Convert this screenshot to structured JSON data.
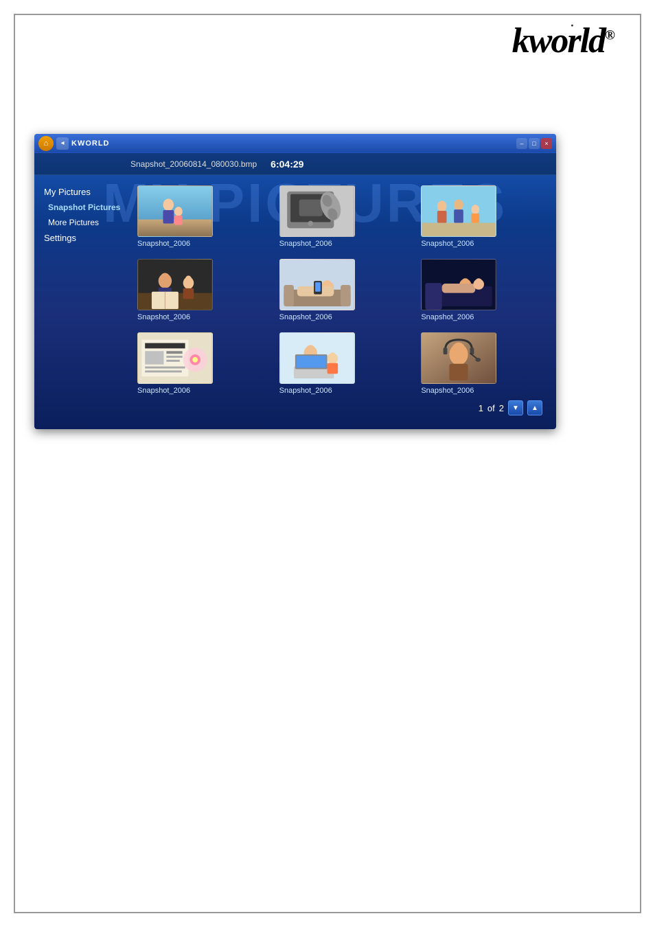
{
  "logo": {
    "text": "kworld",
    "registered": "®"
  },
  "titlebar": {
    "app_name": "KWORLD",
    "filename": "Snapshot_20060814_080030.bmp",
    "time": "6:04:29"
  },
  "bg_text": "MY PICTURES",
  "sidebar": {
    "items": [
      {
        "id": "my-pictures",
        "label": "My Pictures",
        "level": "top"
      },
      {
        "id": "snapshot-pictures",
        "label": "Snapshot Pictures",
        "level": "sub",
        "active": true
      },
      {
        "id": "more-pictures",
        "label": "More Pictures",
        "level": "sub"
      },
      {
        "id": "settings",
        "label": "Settings",
        "level": "top"
      }
    ]
  },
  "gallery": {
    "photos": [
      {
        "id": 1,
        "label": "Snapshot_2006",
        "thumb_class": "thumb-1"
      },
      {
        "id": 2,
        "label": "Snapshot_2006",
        "thumb_class": "thumb-2"
      },
      {
        "id": 3,
        "label": "Snapshot_2006",
        "thumb_class": "thumb-3"
      },
      {
        "id": 4,
        "label": "Snapshot_2006",
        "thumb_class": "thumb-4"
      },
      {
        "id": 5,
        "label": "Snapshot_2006",
        "thumb_class": "thumb-5"
      },
      {
        "id": 6,
        "label": "Snapshot_2006",
        "thumb_class": "thumb-6"
      },
      {
        "id": 7,
        "label": "Snapshot_2006",
        "thumb_class": "thumb-7"
      },
      {
        "id": 8,
        "label": "Snapshot_2006",
        "thumb_class": "thumb-8"
      },
      {
        "id": 9,
        "label": "Snapshot_2006",
        "thumb_class": "thumb-9"
      }
    ],
    "pagination": {
      "current": "1",
      "separator": "of",
      "total": "2",
      "prev_label": "▼",
      "next_label": "▲"
    }
  },
  "window_buttons": {
    "minimize": "–",
    "maximize": "□",
    "close": "×"
  }
}
